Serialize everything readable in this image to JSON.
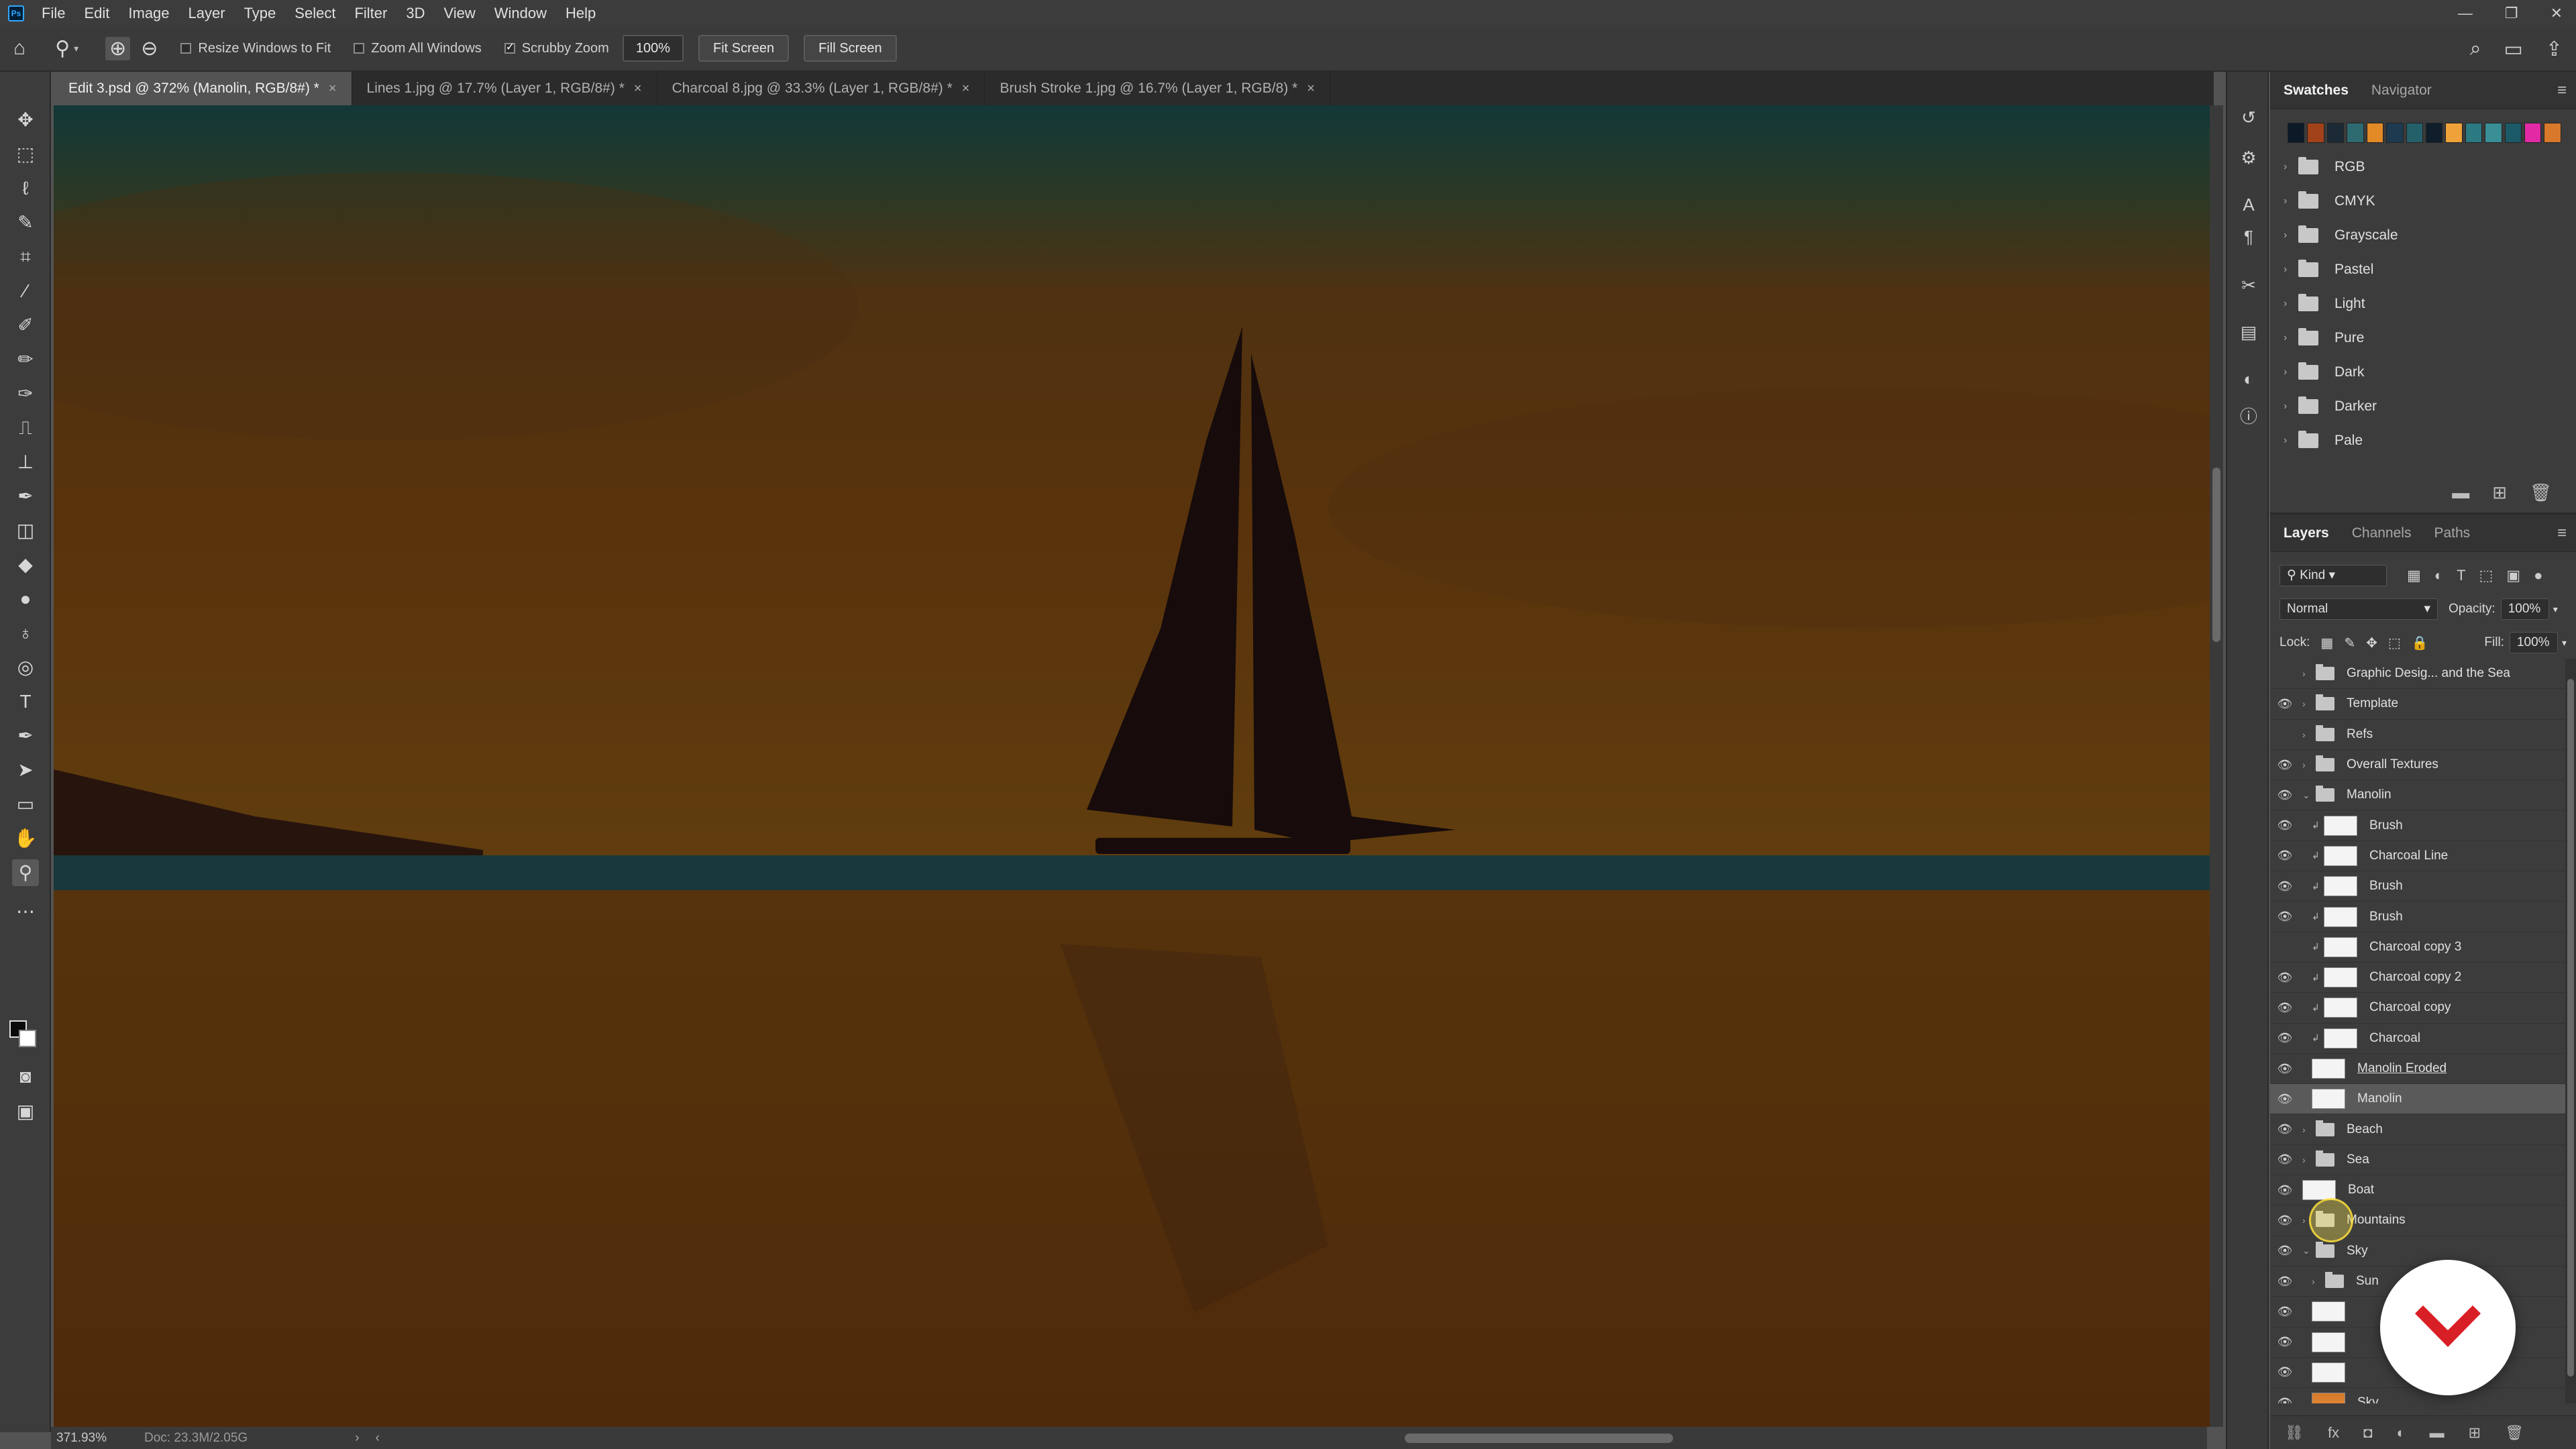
{
  "app": {
    "logo_text": "Ps",
    "menu": [
      "File",
      "Edit",
      "Image",
      "Layer",
      "Type",
      "Select",
      "Filter",
      "3D",
      "View",
      "Window",
      "Help"
    ],
    "window_controls": [
      "—",
      "❐",
      "✕"
    ]
  },
  "options": {
    "resize_windows": "Resize Windows to Fit",
    "zoom_all": "Zoom All Windows",
    "scrubby_zoom": "Scrubby Zoom",
    "zoom_value": "100%",
    "fit_screen": "Fit Screen",
    "fill_screen": "Fill Screen",
    "resize_checked": false,
    "zoom_all_checked": false,
    "scrubby_checked": true
  },
  "tabs": [
    {
      "label": "Edit 3.psd @ 372% (Manolin, RGB/8#) *",
      "active": true
    },
    {
      "label": "Lines 1.jpg @ 17.7% (Layer 1, RGB/8#) *",
      "active": false
    },
    {
      "label": "Charcoal 8.jpg @ 33.3% (Layer 1, RGB/8#) *",
      "active": false
    },
    {
      "label": "Brush Stroke 1.jpg @ 16.7% (Layer 1, RGB/8) *",
      "active": false
    }
  ],
  "status": {
    "zoom": "371.93%",
    "doc_info": "Doc: 23.3M/2.05G"
  },
  "swatches_panel": {
    "tabs": [
      "Swatches",
      "Navigator"
    ],
    "colors": [
      "#0c1a28",
      "#a2421a",
      "#1c2a36",
      "#2e6b70",
      "#e28a26",
      "#1d3a50",
      "#24606a",
      "#0f1e2a",
      "#f0a23a",
      "#2b7a82",
      "#3a8e96",
      "#1b5a66",
      "#e22aa4",
      "#d8782a"
    ],
    "groups": [
      "RGB",
      "CMYK",
      "Grayscale",
      "Pastel",
      "Light",
      "Pure",
      "Dark",
      "Darker",
      "Pale"
    ]
  },
  "layers_panel": {
    "tabs": [
      "Layers",
      "Channels",
      "Paths"
    ],
    "kind_filter": "Kind",
    "blend_mode": "Normal",
    "opacity_label": "Opacity:",
    "opacity_value": "100%",
    "lock_label": "Lock:",
    "fill_label": "Fill:",
    "fill_value": "100%",
    "layers": [
      {
        "name": "Graphic Desig... and the Sea",
        "type": "group",
        "visible": false,
        "indent": 0,
        "selected": false
      },
      {
        "name": "Template",
        "type": "group",
        "visible": true,
        "indent": 0,
        "selected": false
      },
      {
        "name": "Refs",
        "type": "group",
        "visible": false,
        "indent": 0,
        "selected": false
      },
      {
        "name": "Overall Textures",
        "type": "group",
        "visible": true,
        "indent": 0,
        "selected": false
      },
      {
        "name": "Manolin",
        "type": "group-open",
        "visible": true,
        "indent": 0,
        "selected": false
      },
      {
        "name": "Brush",
        "type": "clip",
        "visible": true,
        "indent": 1,
        "selected": false
      },
      {
        "name": "Charcoal Line",
        "type": "clip",
        "visible": true,
        "indent": 1,
        "selected": false
      },
      {
        "name": "Brush",
        "type": "clip",
        "visible": true,
        "indent": 1,
        "selected": false
      },
      {
        "name": "Brush",
        "type": "clip",
        "visible": true,
        "indent": 1,
        "selected": false
      },
      {
        "name": "Charcoal  copy 3",
        "type": "clip",
        "visible": false,
        "indent": 1,
        "selected": false
      },
      {
        "name": "Charcoal  copy 2",
        "type": "clip",
        "visible": true,
        "indent": 1,
        "selected": false
      },
      {
        "name": "Charcoal  copy",
        "type": "clip",
        "visible": true,
        "indent": 1,
        "selected": false
      },
      {
        "name": "Charcoal",
        "type": "clip",
        "visible": true,
        "indent": 1,
        "selected": false
      },
      {
        "name": "Manolin Eroded",
        "type": "layer",
        "visible": true,
        "indent": 1,
        "selected": false,
        "underlined": true
      },
      {
        "name": "Manolin",
        "type": "layer",
        "visible": true,
        "indent": 1,
        "selected": true
      },
      {
        "name": "Beach",
        "type": "group",
        "visible": true,
        "indent": 0,
        "selected": false
      },
      {
        "name": "Sea",
        "type": "group",
        "visible": true,
        "indent": 0,
        "selected": false
      },
      {
        "name": "Boat",
        "type": "layer",
        "visible": true,
        "indent": 0,
        "selected": false
      },
      {
        "name": "Mountains",
        "type": "group",
        "visible": true,
        "indent": 0,
        "selected": false
      },
      {
        "name": "Sky",
        "type": "group-open",
        "visible": true,
        "indent": 0,
        "selected": false
      },
      {
        "name": "Sun",
        "type": "group",
        "visible": true,
        "indent": 1,
        "selected": false
      },
      {
        "name": "",
        "type": "layer",
        "visible": true,
        "indent": 1,
        "selected": false
      },
      {
        "name": "",
        "type": "layer",
        "visible": true,
        "indent": 1,
        "selected": false
      },
      {
        "name": "",
        "type": "layer",
        "visible": true,
        "indent": 1,
        "selected": false
      },
      {
        "name": "Sky",
        "type": "layer-sky",
        "visible": true,
        "indent": 1,
        "selected": false
      }
    ]
  },
  "icons": {
    "home": "⌂",
    "zoom": "🔍",
    "search": "⌕",
    "eye": "👁"
  },
  "colors": {
    "accent": "#31a8ff",
    "sky_top": "#2f8d8c",
    "sky_mid": "#e0801f",
    "sea_band": "#3e8e96",
    "sea": "#d9821f",
    "boat": "#3a1e1c",
    "brand": "#d81f26"
  }
}
